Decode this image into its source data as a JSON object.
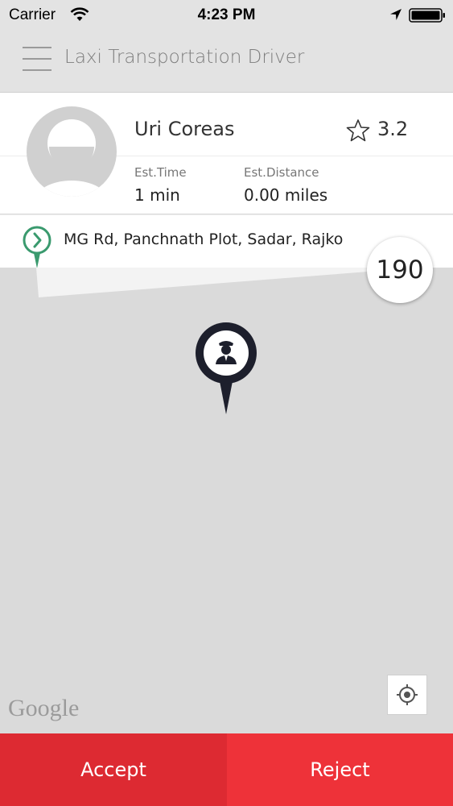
{
  "status_bar": {
    "carrier": "Carrier",
    "time": "4:23 PM",
    "icons": [
      "wifi-icon",
      "location-arrow-icon",
      "battery-icon"
    ]
  },
  "nav": {
    "title": "Laxi Transportation Driver",
    "menu_icon": "hamburger-menu-icon"
  },
  "rider": {
    "name": "Uri Coreas",
    "rating": "3.2",
    "est_time_label": "Est.Time",
    "est_time_value": "1 min",
    "est_distance_label": "Est.Distance",
    "est_distance_value": "0.00 miles"
  },
  "trip": {
    "pickup_address": "MG Rd, Panchnath Plot, Sadar, Rajko",
    "fare": "190"
  },
  "map": {
    "attribution": "Google"
  },
  "actions": {
    "accept_label": "Accept",
    "reject_label": "Reject"
  },
  "colors": {
    "accept": "#dd2a32",
    "reject": "#ee3239",
    "pickup_pin": "#3a9a6e",
    "driver_marker": "#1d1f2c"
  }
}
